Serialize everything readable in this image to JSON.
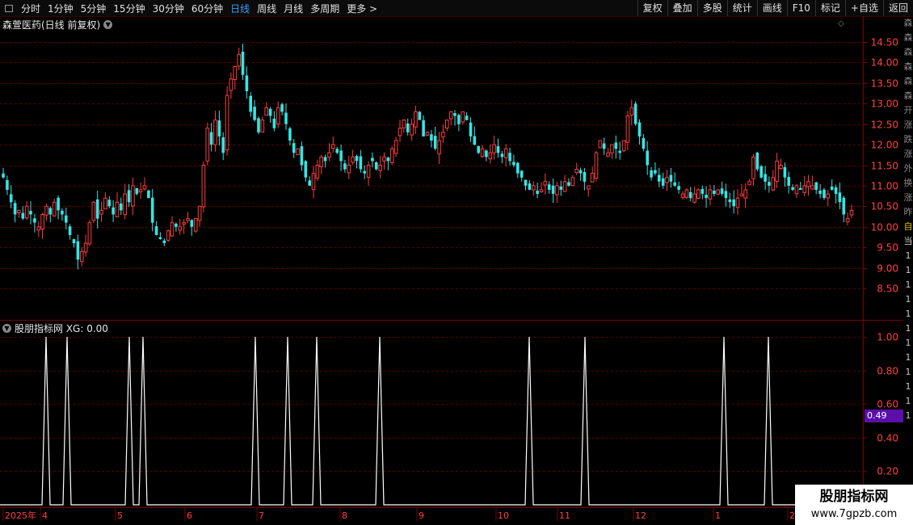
{
  "toolbar": {
    "periods": [
      "分时",
      "1分钟",
      "5分钟",
      "15分钟",
      "30分钟",
      "60分钟",
      "日线",
      "周线",
      "月线",
      "多周期",
      "更多 >"
    ],
    "active_period": "日线",
    "buttons": [
      "复权",
      "叠加",
      "多股",
      "统计",
      "画线",
      "F10",
      "标记",
      "+自选",
      "返回"
    ]
  },
  "main_chart": {
    "title": "森萱医药(日线 前复权)",
    "price_labels": [
      "14.50",
      "14.00",
      "13.50",
      "13.00",
      "12.50",
      "12.00",
      "11.50",
      "11.00",
      "10.50",
      "10.00",
      "9.50",
      "9.00",
      "8.50"
    ]
  },
  "indicator": {
    "title": "股朋指标网 XG: 0.00",
    "axis_labels": [
      "1.00",
      "0.80",
      "0.60",
      "0.40",
      "0.20"
    ],
    "current_value_badge": "0.49"
  },
  "x_axis": {
    "labels": [
      "2025年",
      "4",
      "5",
      "6",
      "7",
      "8",
      "9",
      "10",
      "11",
      "12",
      "1",
      "2"
    ]
  },
  "right_edge_chars": [
    "森",
    "森",
    "森",
    "森",
    "森",
    "森",
    "开",
    "涨",
    "跌",
    "涨",
    "外",
    "换",
    "涨",
    "昨",
    "自",
    "当",
    "1",
    "1",
    "1",
    "1",
    "1",
    "1",
    "1",
    "1",
    "1",
    "1",
    "1",
    "1"
  ],
  "watermark": {
    "line1": "股朋指标网",
    "line2": "www.7gpzb.com"
  },
  "colors": {
    "up": "#ff3b3b",
    "down": "#33e6e6",
    "grid": "#5a0000",
    "active_tab": "#3aa0ff",
    "badge": "#5b0fa8"
  },
  "chart_data": {
    "type": "candlestick",
    "title": "森萱医药(日线 前复权)",
    "ylim": [
      8.3,
      14.9
    ],
    "y_ticks": [
      14.5,
      14.0,
      13.5,
      13.0,
      12.5,
      12.0,
      11.5,
      11.0,
      10.5,
      10.0,
      9.5,
      9.0,
      8.5
    ],
    "month_labels": [
      "2025年",
      "4",
      "5",
      "6",
      "7",
      "8",
      "9",
      "10",
      "11",
      "12",
      "1",
      "2"
    ],
    "closes": [
      11.2,
      10.9,
      10.6,
      10.3,
      10.4,
      10.2,
      10.5,
      10.3,
      10.1,
      10.0,
      10.3,
      10.5,
      10.3,
      10.6,
      10.4,
      10.3,
      10.1,
      9.8,
      9.6,
      9.2,
      9.4,
      9.6,
      10.1,
      10.6,
      10.2,
      10.4,
      10.7,
      10.5,
      10.3,
      10.6,
      10.4,
      10.8,
      10.6,
      11.0,
      10.8,
      10.9,
      11.0,
      10.7,
      10.1,
      9.8,
      9.7,
      9.6,
      9.9,
      10.1,
      10.0,
      10.0,
      10.1,
      10.2,
      10.0,
      10.2,
      10.5,
      11.5,
      12.4,
      12.0,
      12.6,
      12.2,
      11.8,
      13.2,
      13.6,
      13.9,
      14.2,
      13.7,
      13.3,
      12.8,
      12.6,
      12.3,
      12.6,
      12.9,
      12.7,
      12.4,
      12.9,
      12.8,
      12.5,
      12.1,
      11.8,
      11.9,
      11.5,
      11.2,
      11.0,
      11.3,
      11.5,
      11.7,
      11.6,
      11.8,
      12.0,
      11.8,
      11.6,
      11.4,
      11.5,
      11.7,
      11.6,
      11.4,
      11.3,
      11.5,
      11.6,
      11.4,
      11.5,
      11.7,
      11.6,
      11.9,
      12.1,
      12.4,
      12.6,
      12.3,
      12.5,
      12.8,
      12.6,
      12.2,
      12.3,
      12.1,
      11.9,
      12.1,
      12.3,
      12.6,
      12.8,
      12.7,
      12.5,
      12.8,
      12.6,
      12.2,
      12.0,
      11.8,
      11.9,
      11.7,
      11.8,
      12.0,
      11.8,
      11.7,
      11.9,
      11.6,
      11.5,
      11.3,
      11.2,
      11.0,
      10.9,
      11.0,
      10.8,
      10.9,
      11.1,
      10.9,
      10.8,
      11.0,
      10.9,
      11.1,
      11.0,
      11.2,
      11.4,
      11.3,
      11.1,
      11.0,
      11.3,
      11.8,
      12.1,
      11.9,
      11.8,
      12.0,
      11.9,
      11.8,
      12.1,
      12.7,
      12.9,
      12.5,
      12.2,
      11.9,
      11.5,
      11.2,
      11.3,
      11.1,
      11.0,
      11.2,
      11.1,
      11.0,
      10.9,
      10.8,
      10.9,
      10.7,
      10.8,
      10.9,
      10.8,
      10.7,
      10.9,
      10.8,
      10.9,
      10.8,
      10.7,
      10.6,
      10.5,
      10.7,
      10.8,
      10.9,
      11.1,
      11.7,
      11.4,
      11.2,
      11.1,
      11.0,
      11.2,
      11.6,
      11.5,
      11.2,
      11.0,
      10.9,
      11.0,
      10.9,
      11.0,
      11.1,
      11.0,
      10.9,
      10.8,
      10.7,
      10.8,
      10.9,
      10.8,
      10.6,
      10.3,
      10.2,
      10.4
    ],
    "xg_signal_positions": [
      57,
      83,
      160,
      177,
      316,
      356,
      392,
      470,
      655,
      724,
      896,
      951
    ],
    "xg_current": 0.0
  }
}
